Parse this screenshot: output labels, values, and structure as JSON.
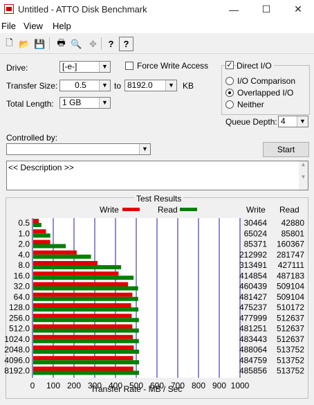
{
  "window": {
    "title": "Untitled - ATTO Disk Benchmark",
    "minimize": "—",
    "maximize": "☐",
    "close": "✕"
  },
  "menu": {
    "file": "File",
    "view": "View",
    "help": "Help"
  },
  "toolbar": {
    "icons": [
      "new-icon",
      "open-icon",
      "save-icon",
      "print-icon",
      "print-preview-icon",
      "move-icon",
      "help-icon",
      "context-help-icon"
    ],
    "glyphs": [
      "🗋",
      "📂",
      "💾",
      "🖶",
      "🔍",
      "✥",
      "?",
      "?"
    ]
  },
  "settings": {
    "drive_label": "Drive:",
    "drive_value": "[-e-]",
    "transfer_size_label": "Transfer Size:",
    "transfer_from": "0.5",
    "to_label": "to",
    "transfer_to": "8192.0",
    "kb_label": "KB",
    "total_length_label": "Total Length:",
    "total_length_value": "1 GB",
    "force_write_label": "Force Write Access",
    "force_write_checked": false,
    "direct_io_label": "Direct I/O",
    "direct_io_checked": true,
    "io_comparison_label": "I/O Comparison",
    "overlapped_io_label": "Overlapped I/O",
    "neither_label": "Neither",
    "selected_io": "Overlapped I/O",
    "queue_depth_label": "Queue Depth:",
    "queue_depth_value": "4",
    "controlled_by_label": "Controlled by:",
    "controlled_by_value": "",
    "start_label": "Start",
    "description": "<< Description >>"
  },
  "chart_data": {
    "type": "bar",
    "title": "Test Results",
    "orientation": "horizontal",
    "xlabel": "Transfer Rate - MB / Sec",
    "xlim": [
      0,
      1000
    ],
    "xticks": [
      "0",
      "100",
      "200",
      "300",
      "400",
      "500",
      "600",
      "700",
      "800",
      "900",
      "1000"
    ],
    "categories": [
      "0.5",
      "1.0",
      "2.0",
      "4.0",
      "8.0",
      "16.0",
      "32.0",
      "64.0",
      "128.0",
      "256.0",
      "512.0",
      "1024.0",
      "2048.0",
      "4096.0",
      "8192.0"
    ],
    "series": [
      {
        "name": "Write",
        "color": "#e00000",
        "values": [
          30.464,
          65.024,
          85.371,
          212.992,
          313.491,
          414.854,
          460.439,
          481.427,
          475.237,
          477.999,
          481.251,
          483.443,
          488.064,
          484.759,
          485.856
        ]
      },
      {
        "name": "Read",
        "color": "#008000",
        "values": [
          42.88,
          85.801,
          160.367,
          281.747,
          427.111,
          487.183,
          509.104,
          509.104,
          510.172,
          512.637,
          512.637,
          512.637,
          513.752,
          513.752,
          513.752
        ]
      }
    ],
    "table_headers": [
      "Write",
      "Read"
    ],
    "write_column": [
      "30464",
      "65024",
      "85371",
      "212992",
      "313491",
      "414854",
      "460439",
      "481427",
      "475237",
      "477999",
      "481251",
      "483443",
      "488064",
      "484759",
      "485856"
    ],
    "read_column": [
      "42880",
      "85801",
      "160367",
      "281747",
      "427111",
      "487183",
      "509104",
      "509104",
      "510172",
      "512637",
      "512637",
      "512637",
      "513752",
      "513752",
      "513752"
    ]
  }
}
